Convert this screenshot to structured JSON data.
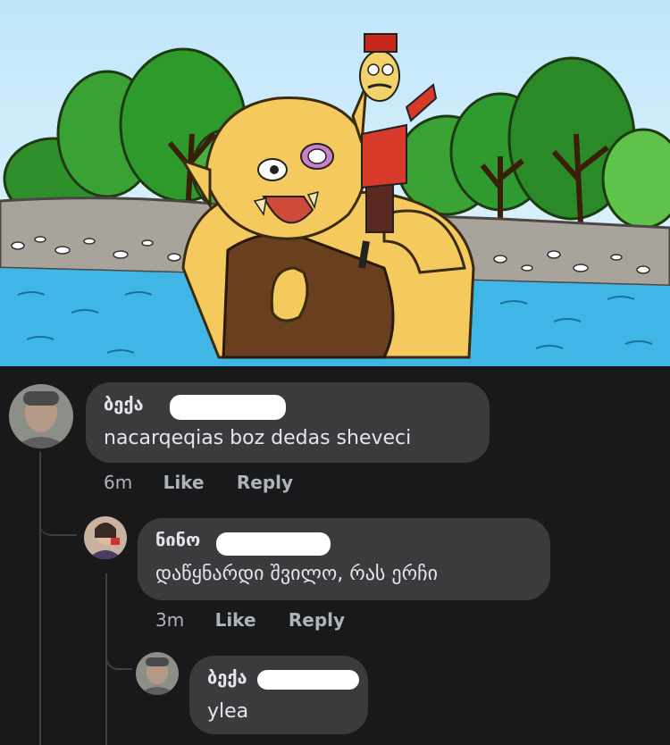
{
  "comments": [
    {
      "author": "ბექა",
      "text": "nacarqeqias boz dedas sheveci",
      "time": "6m",
      "like_label": "Like",
      "reply_label": "Reply"
    },
    {
      "author": "ნინო",
      "text": "დაწყნარდი შვილო, რას ერჩი",
      "time": "3m",
      "like_label": "Like",
      "reply_label": "Reply"
    },
    {
      "author": "ბექა",
      "text": "ylea"
    }
  ]
}
